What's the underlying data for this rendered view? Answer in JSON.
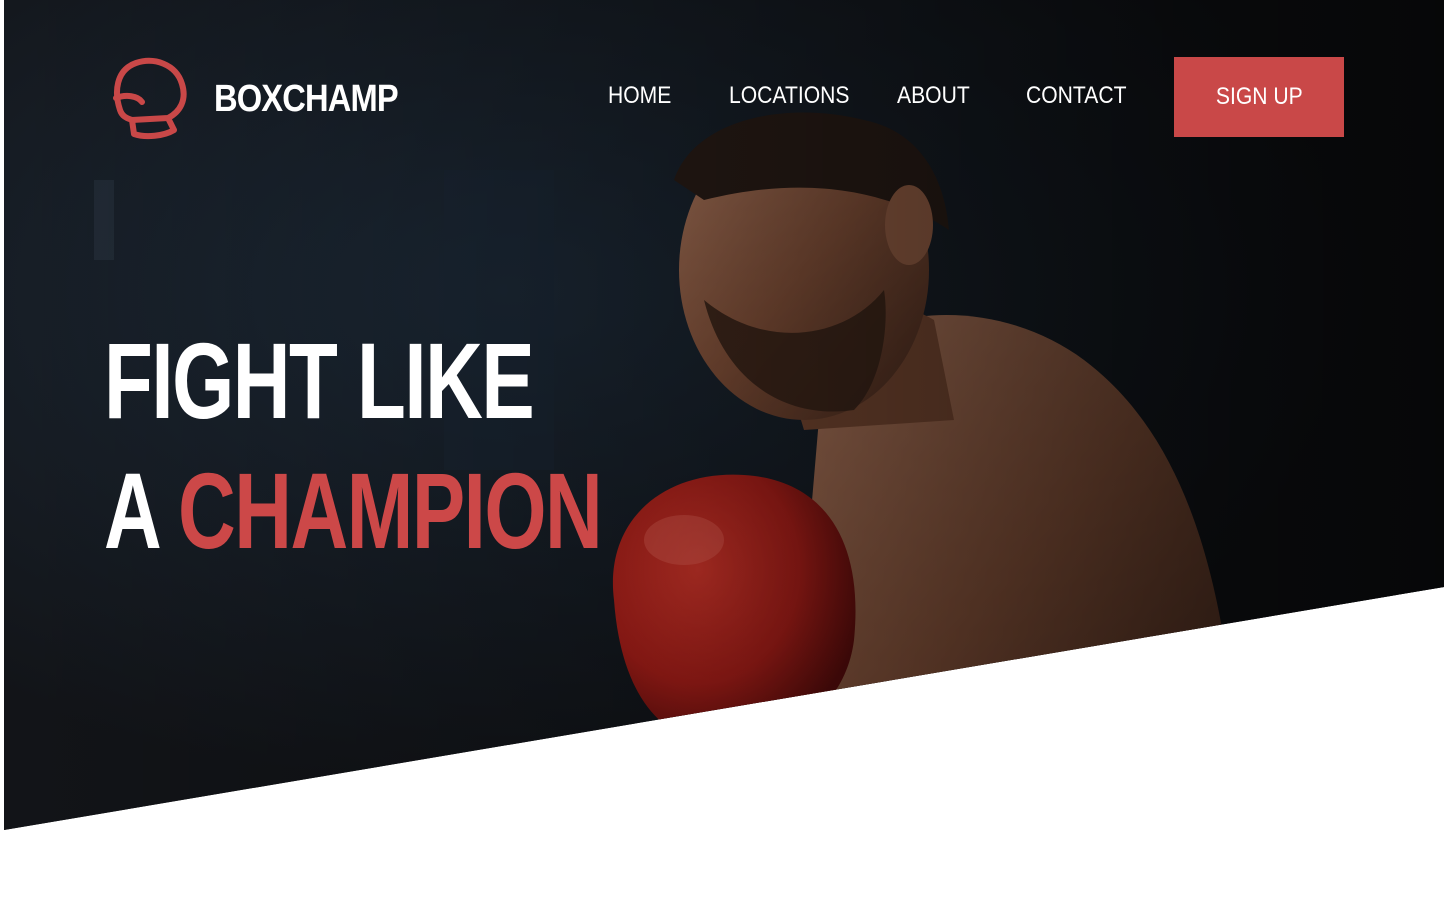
{
  "brand": {
    "name": "BOXCHAMP",
    "logo_icon": "boxing-glove-icon",
    "accent_color": "#c94848"
  },
  "nav": {
    "items": [
      {
        "label": "HOME"
      },
      {
        "label": "LOCATIONS"
      },
      {
        "label": "ABOUT"
      },
      {
        "label": "CONTACT"
      }
    ],
    "cta_label": "SIGN UP"
  },
  "hero": {
    "line1": "FIGHT LIKE",
    "line2_prefix": "A",
    "line2_accent": "CHAMPION",
    "background": "#141414",
    "image": "boxer-with-red-glove"
  }
}
